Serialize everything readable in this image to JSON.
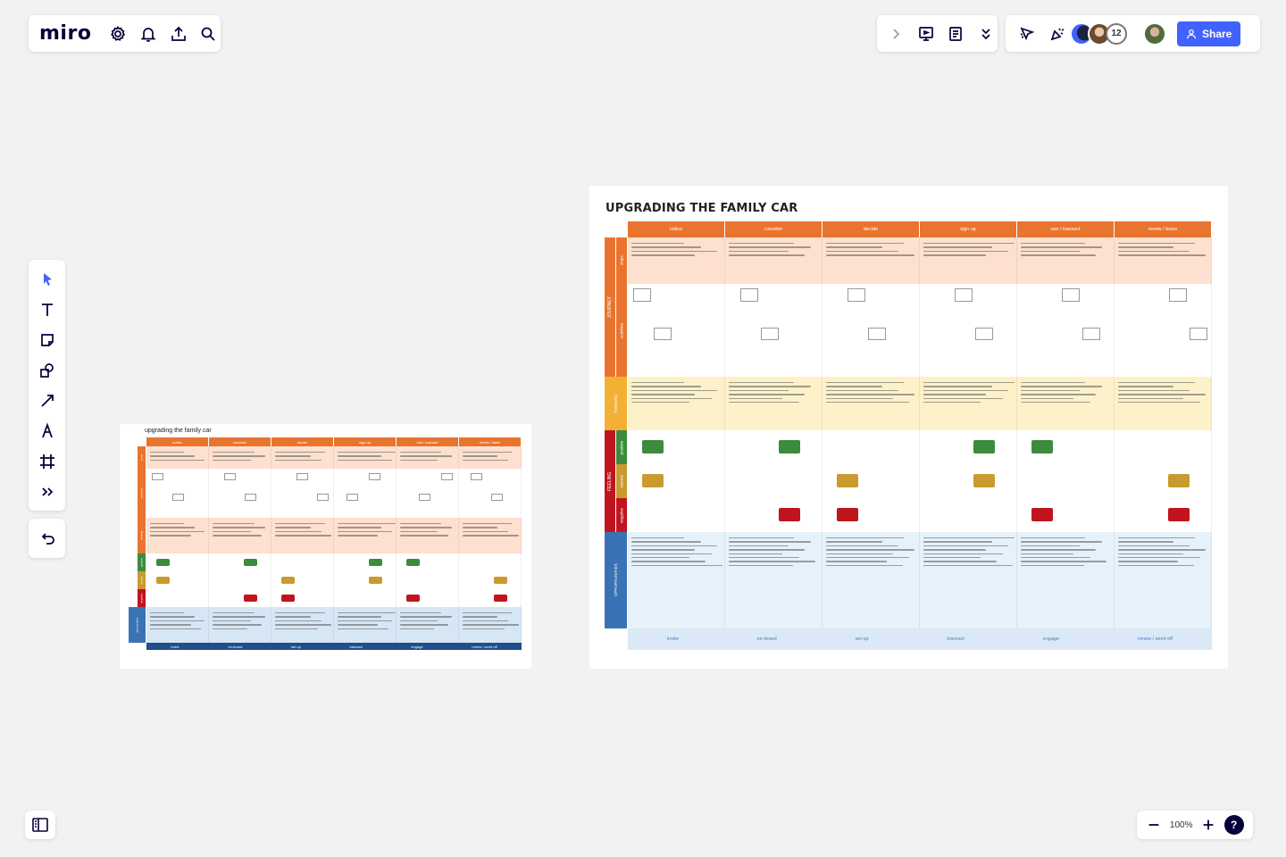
{
  "app": {
    "logo": "miro",
    "share_label": "Share",
    "collaborator_count": "12",
    "zoom_level": "100%",
    "help_label": "?"
  },
  "colors": {
    "accent": "#4262ff",
    "stage_orange": "#e9742e",
    "row_orange": "#fde0cf",
    "row_yellow": "#fdf1c9",
    "row_blue": "#e7f1fa",
    "positive_green": "#3d8b3d",
    "neutral_gold": "#c99a2e",
    "negative_red": "#c0141e",
    "opportunity_blue": "#3a73b5"
  },
  "small_board": {
    "title": "upgrading the family car",
    "stages": [
      "notice",
      "consider",
      "decide",
      "sign up",
      "use / transact",
      "renew / leave"
    ],
    "rows": [
      "steps",
      "activities",
      "thinking",
      "positive",
      "neutral",
      "negative",
      "opportunities"
    ],
    "channels": [
      "invite",
      "on-board",
      "set up",
      "transact",
      "engage",
      "renew / send off"
    ]
  },
  "big_board": {
    "title": "UPGRADING THE FAMILY CAR",
    "stages": [
      "notice",
      "consider",
      "decide",
      "sign up",
      "use / transact",
      "renew / leave"
    ],
    "groups": [
      "JOURNEY",
      "THINKING",
      "FEELING",
      "OPPORTUNITIES"
    ],
    "journey_rows": [
      "steps",
      "activities"
    ],
    "feeling_rows": [
      "positive",
      "neutral",
      "negative"
    ],
    "channels": [
      "invite",
      "on-board",
      "set up",
      "transact",
      "engage",
      "renew / send off"
    ]
  }
}
